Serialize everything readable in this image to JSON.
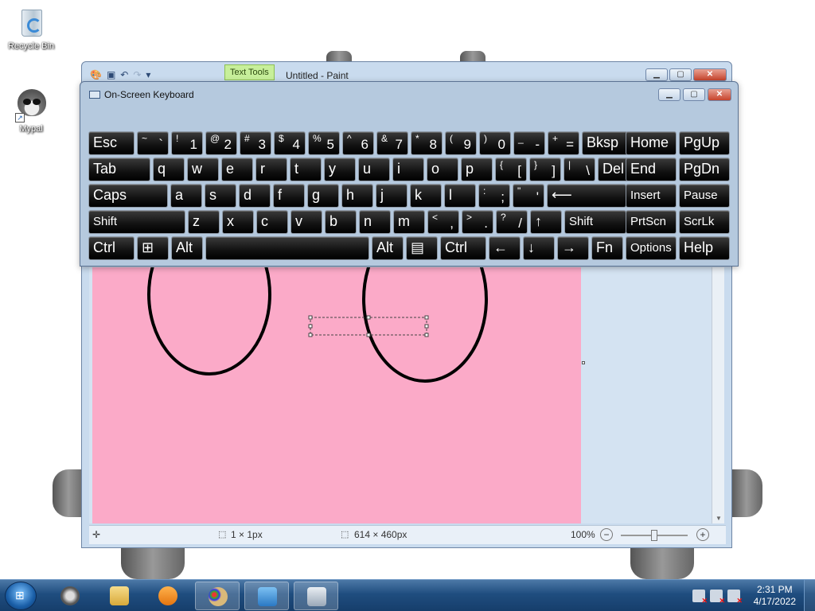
{
  "desktop": {
    "icons": [
      {
        "label": "Recycle Bin",
        "icon": "recycle-bin-icon"
      },
      {
        "label": "Mypal",
        "icon": "mypal-raccoon-icon"
      }
    ]
  },
  "paint": {
    "title": "Untitled - Paint",
    "contextual_tab": "Text Tools",
    "canvas_color": "#fbaac8",
    "status": {
      "cursor_pos": "1 × 1px",
      "canvas_size": "614 × 460px",
      "zoom": "100%",
      "zoom_out": "−",
      "zoom_in": "+"
    }
  },
  "osk": {
    "title": "On-Screen Keyboard",
    "rows": [
      [
        {
          "label": "Esc"
        },
        {
          "sym": "~",
          "main": "`"
        },
        {
          "sym": "!",
          "main": "1"
        },
        {
          "sym": "@",
          "main": "2"
        },
        {
          "sym": "#",
          "main": "3"
        },
        {
          "sym": "$",
          "main": "4"
        },
        {
          "sym": "%",
          "main": "5"
        },
        {
          "sym": "^",
          "main": "6"
        },
        {
          "sym": "&",
          "main": "7"
        },
        {
          "sym": "*",
          "main": "8"
        },
        {
          "sym": "(",
          "main": "9"
        },
        {
          "sym": ")",
          "main": "0"
        },
        {
          "sym": "_",
          "main": "-"
        },
        {
          "sym": "+",
          "main": "="
        },
        {
          "label": "Bksp"
        },
        {
          "label": "Home"
        },
        {
          "label": "PgUp"
        }
      ],
      [
        {
          "label": "Tab"
        },
        {
          "label": "q"
        },
        {
          "label": "w"
        },
        {
          "label": "e"
        },
        {
          "label": "r"
        },
        {
          "label": "t"
        },
        {
          "label": "y"
        },
        {
          "label": "u"
        },
        {
          "label": "i"
        },
        {
          "label": "o"
        },
        {
          "label": "p"
        },
        {
          "sym": "{",
          "main": "["
        },
        {
          "sym": "}",
          "main": "]"
        },
        {
          "sym": "|",
          "main": "\\"
        },
        {
          "label": "Del"
        },
        {
          "label": "End"
        },
        {
          "label": "PgDn"
        }
      ],
      [
        {
          "label": "Caps"
        },
        {
          "label": "a"
        },
        {
          "label": "s"
        },
        {
          "label": "d"
        },
        {
          "label": "f"
        },
        {
          "label": "g"
        },
        {
          "label": "h"
        },
        {
          "label": "j"
        },
        {
          "label": "k"
        },
        {
          "label": "l"
        },
        {
          "sym": ":",
          "main": ";"
        },
        {
          "sym": "\"",
          "main": "'"
        },
        {
          "label": "⟵"
        },
        {
          "label": "Insert"
        },
        {
          "label": "Pause"
        }
      ],
      [
        {
          "label": "Shift"
        },
        {
          "label": "z"
        },
        {
          "label": "x"
        },
        {
          "label": "c"
        },
        {
          "label": "v"
        },
        {
          "label": "b"
        },
        {
          "label": "n"
        },
        {
          "label": "m"
        },
        {
          "sym": "<",
          "main": ","
        },
        {
          "sym": ">",
          "main": "."
        },
        {
          "sym": "?",
          "main": "/"
        },
        {
          "label": "↑"
        },
        {
          "label": "Shift"
        },
        {
          "label": "PrtScn"
        },
        {
          "label": "ScrLk"
        }
      ],
      [
        {
          "label": "Ctrl"
        },
        {
          "label": "⊞"
        },
        {
          "label": "Alt"
        },
        {
          "label": ""
        },
        {
          "label": "Alt"
        },
        {
          "label": "▤"
        },
        {
          "label": "Ctrl"
        },
        {
          "label": "←"
        },
        {
          "label": "↓"
        },
        {
          "label": "→"
        },
        {
          "label": "Fn"
        },
        {
          "label": "Options"
        },
        {
          "label": "Help"
        }
      ]
    ]
  },
  "taskbar": {
    "clock_time": "2:31 PM",
    "clock_date": "4/17/2022"
  }
}
